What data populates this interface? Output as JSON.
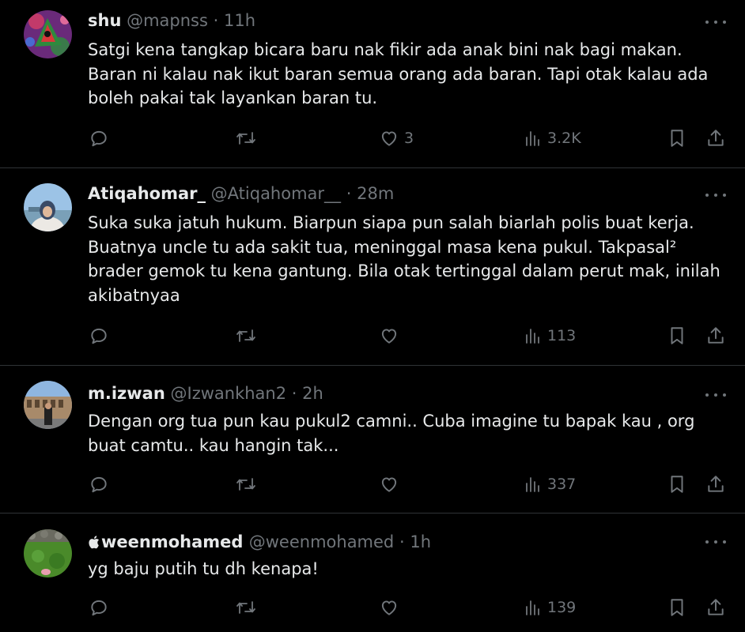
{
  "tweets": [
    {
      "name": "shu",
      "handle": "@mapnss",
      "dot": "·",
      "time": "11h",
      "text": "Satgi kena tangkap bicara baru nak fikir ada anak bini nak bagi makan. Baran ni kalau nak ikut baran semua orang ada baran. Tapi otak kalau ada boleh pakai tak layankan baran tu.",
      "reply_count": "",
      "retweet_count": "",
      "like_count": "3",
      "view_count": "3.2K"
    },
    {
      "name": "Atiqahomar_",
      "handle": "@Atiqahomar__",
      "dot": "·",
      "time": "28m",
      "text": "Suka suka jatuh hukum. Biarpun siapa pun salah biarlah polis buat kerja. Buatnya uncle tu ada sakit tua, meninggal masa kena pukul. Takpasal² brader gemok tu kena gantung. Bila otak tertinggal dalam perut mak, inilah akibatnyaa",
      "reply_count": "",
      "retweet_count": "",
      "like_count": "",
      "view_count": "113"
    },
    {
      "name": "m.izwan",
      "handle": "@Izwankhan2",
      "dot": "·",
      "time": "2h",
      "text": "Dengan org tua pun kau pukul2 camni.. Cuba imagine tu bapak kau , org buat camtu.. kau hangin tak...",
      "reply_count": "",
      "retweet_count": "",
      "like_count": "",
      "view_count": "337"
    },
    {
      "name": "weenmohamed",
      "handle": "@weenmohamed",
      "dot": "·",
      "time": "1h",
      "text": "yg baju putih tu dh kenapa!",
      "reply_count": "",
      "retweet_count": "",
      "like_count": "",
      "view_count": "139"
    }
  ],
  "icons": {
    "reply": "reply-icon",
    "retweet": "retweet-icon",
    "like": "heart-icon",
    "views": "views-icon",
    "bookmark": "bookmark-icon",
    "share": "share-icon",
    "more": "more-icon"
  },
  "colors": {
    "background": "#000000",
    "text": "#e7e9ea",
    "muted": "#71767b",
    "divider": "#2f3336"
  }
}
